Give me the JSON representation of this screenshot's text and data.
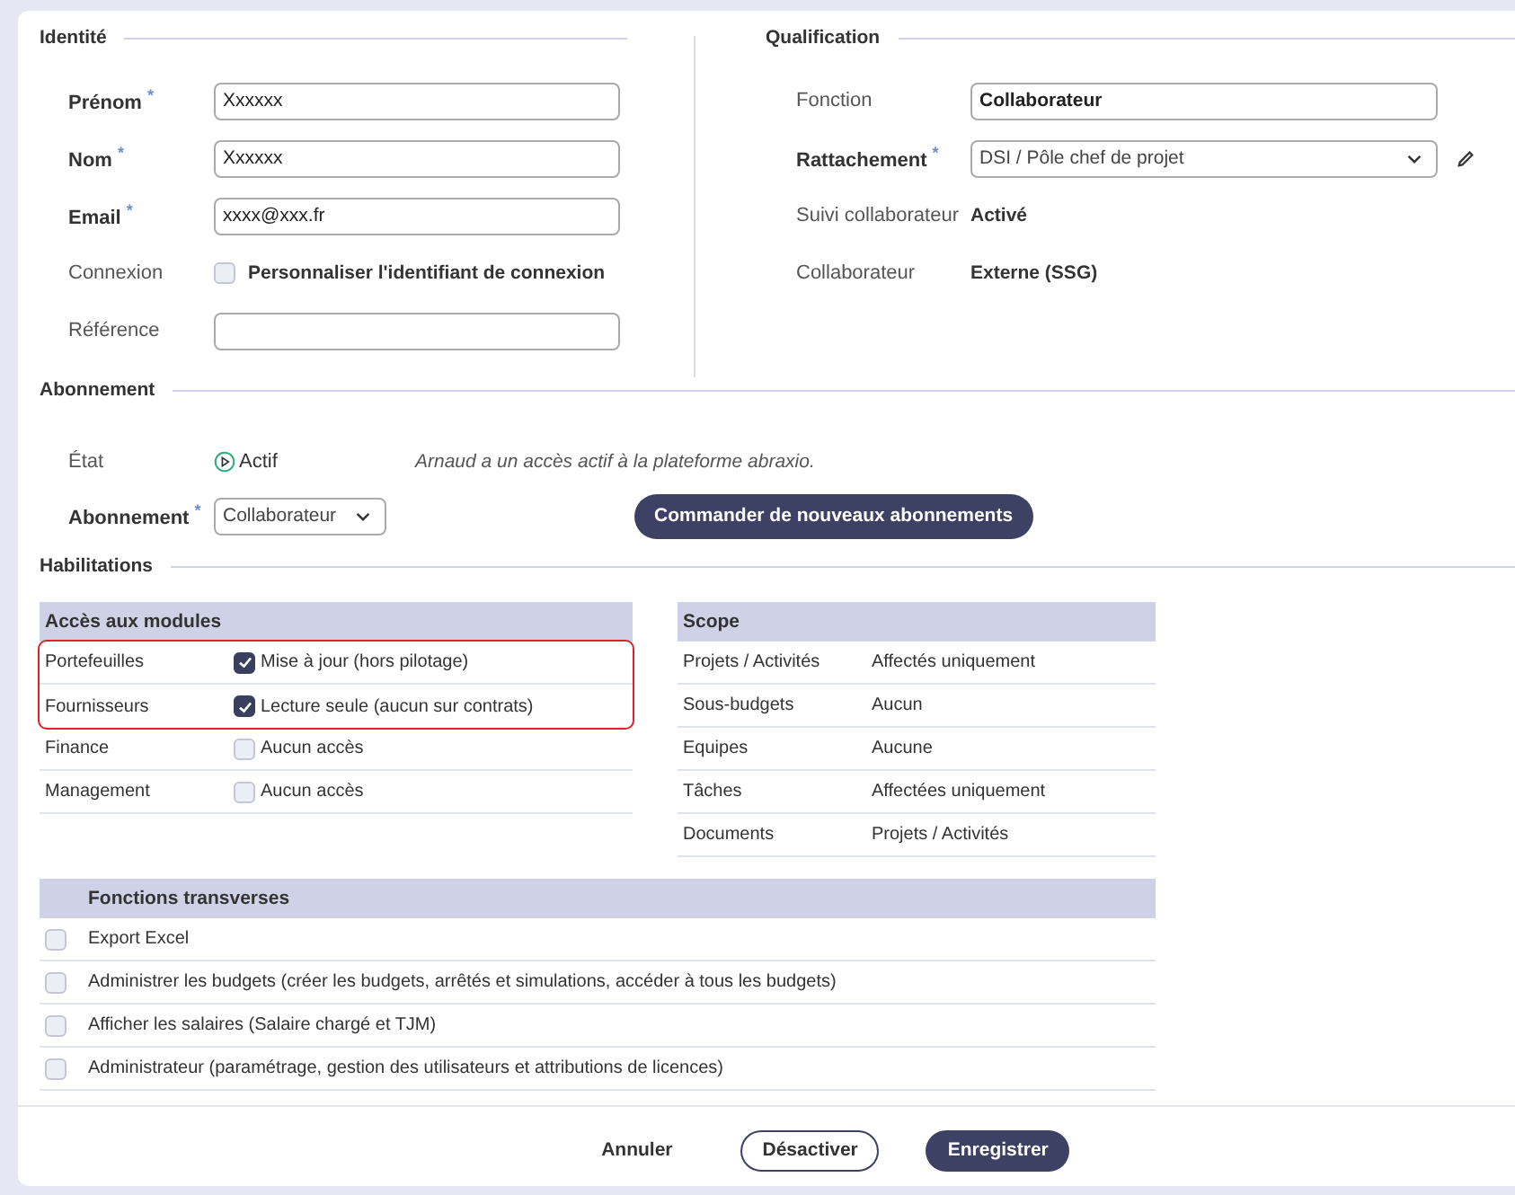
{
  "identite": {
    "title": "Identité",
    "fields": [
      {
        "label": "Prénom",
        "required_mark": "*",
        "kind": "input",
        "value": "Xxxxxx"
      },
      {
        "label": "Nom",
        "required_mark": "*",
        "kind": "input",
        "value": "Xxxxxx"
      },
      {
        "label": "Email",
        "required_mark": "*",
        "kind": "input",
        "value": "xxxx@xxx.fr"
      },
      {
        "label": "Connexion",
        "kind": "checkbox",
        "checked": false,
        "option": "Personnaliser l'identifiant de connexion"
      },
      {
        "label": "Référence",
        "kind": "input"
      }
    ]
  },
  "qualification": {
    "title": "Qualification",
    "fields": [
      {
        "label": "Fonction",
        "kind": "input",
        "value": "Collaborateur"
      },
      {
        "label": "Rattachement",
        "required_mark": "*",
        "kind": "select",
        "value": "DSI / Pôle chef de projet"
      },
      {
        "label": "Suivi collaborateur",
        "kind": "text",
        "value": "Activé"
      },
      {
        "label": "Collaborateur",
        "kind": "text",
        "value": "Externe (SSG)"
      }
    ]
  },
  "abonnement": {
    "title": "Abonnement",
    "state_label": "État",
    "state": "Actif",
    "message": "Arnaud a un accès actif à la plateforme abraxio.",
    "select_label": "Abonnement",
    "select_required_mark": "*",
    "select_value": "Collaborateur",
    "order_button": "Commander de nouveaux abonnements"
  },
  "habilitations": {
    "title": "Habilitations",
    "modules": {
      "header": "Accès aux modules",
      "rows": [
        {
          "module": "Portefeuilles",
          "access": "Mise à jour (hors pilotage)",
          "checked": true,
          "highlighted": true
        },
        {
          "module": "Fournisseurs",
          "access": "Lecture seule (aucun sur contrats)",
          "checked": true,
          "highlighted": true
        },
        {
          "module": "Finance",
          "access": "Aucun accès",
          "checked": false,
          "highlighted": false
        },
        {
          "module": "Management",
          "access": "Aucun accès",
          "checked": false,
          "highlighted": false
        }
      ]
    },
    "scope": {
      "header": "Scope",
      "rows": [
        {
          "item": "Projets / Activités",
          "value": "Affectés uniquement"
        },
        {
          "item": "Sous-budgets",
          "value": "Aucun"
        },
        {
          "item": "Equipes",
          "value": "Aucune"
        },
        {
          "item": "Tâches",
          "value": "Affectées uniquement"
        },
        {
          "item": "Documents",
          "value": "Projets / Activités"
        }
      ]
    },
    "fonctions": {
      "header": "Fonctions transverses",
      "rows": [
        {
          "label": "Export Excel",
          "checked": false
        },
        {
          "label": "Administrer les budgets (créer les budgets, arrêtés et simulations, accéder à tous les budgets)",
          "checked": false
        },
        {
          "label": "Afficher les salaires (Salaire chargé et TJM)",
          "checked": false
        },
        {
          "label": "Administrateur (paramétrage, gestion des utilisateurs et attributions de licences)",
          "checked": false
        }
      ]
    }
  },
  "buttons": [
    {
      "label": "Annuler",
      "kind": "text"
    },
    {
      "label": "Désactiver",
      "kind": "outline"
    },
    {
      "label": "Enregistrer",
      "kind": "primary"
    }
  ]
}
